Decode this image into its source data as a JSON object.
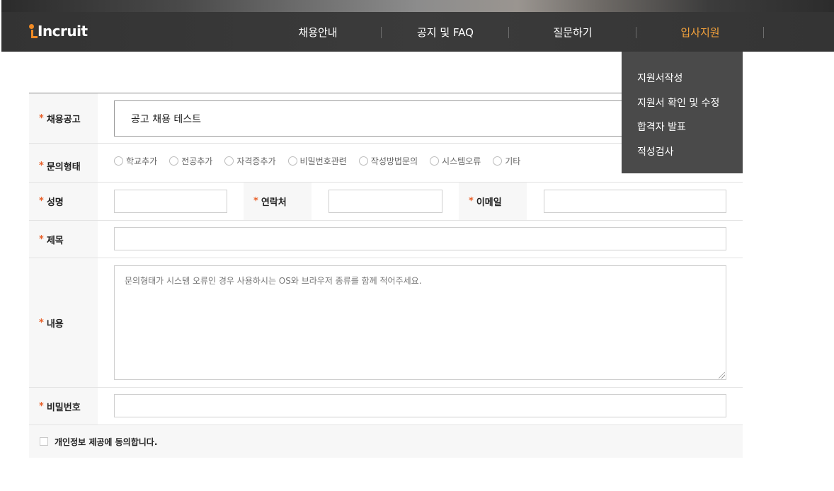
{
  "header": {
    "logo_text": "Incruit",
    "nav": [
      {
        "label": "채용안내"
      },
      {
        "label": "공지 및 FAQ"
      },
      {
        "label": "질문하기"
      },
      {
        "label": "입사지원"
      }
    ],
    "active_color": "#f5a33c"
  },
  "dropdown": {
    "items": [
      {
        "label": "지원서작성"
      },
      {
        "label": "지원서 확인 및 수정"
      },
      {
        "label": "합격자 발표"
      },
      {
        "label": "적성검사"
      }
    ]
  },
  "form": {
    "required_mark": "*",
    "posting": {
      "label": "채용공고",
      "value": "공고 채용 테스트"
    },
    "inquiry_type": {
      "label": "문의형태",
      "options": [
        "학교추가",
        "전공추가",
        "자격증추가",
        "비밀번호관련",
        "작성방법문의",
        "시스템오류",
        "기타"
      ]
    },
    "name": {
      "label": "성명",
      "value": ""
    },
    "contact": {
      "label": "연락처",
      "value": ""
    },
    "email": {
      "label": "이메일",
      "value": ""
    },
    "subject": {
      "label": "제목",
      "value": ""
    },
    "content": {
      "label": "내용",
      "placeholder": "문의형태가 시스템 오류인 경우 사용하시는 OS와 브라우저 종류를 함께 적어주세요."
    },
    "password": {
      "label": "비밀번호",
      "value": ""
    },
    "agree": {
      "label": "개인정보 제공에 동의합니다.",
      "checked": false
    }
  },
  "colors": {
    "required": "#e8602a",
    "header_bg": "#3a3a3a",
    "dropdown_bg": "#4a4a4a"
  }
}
